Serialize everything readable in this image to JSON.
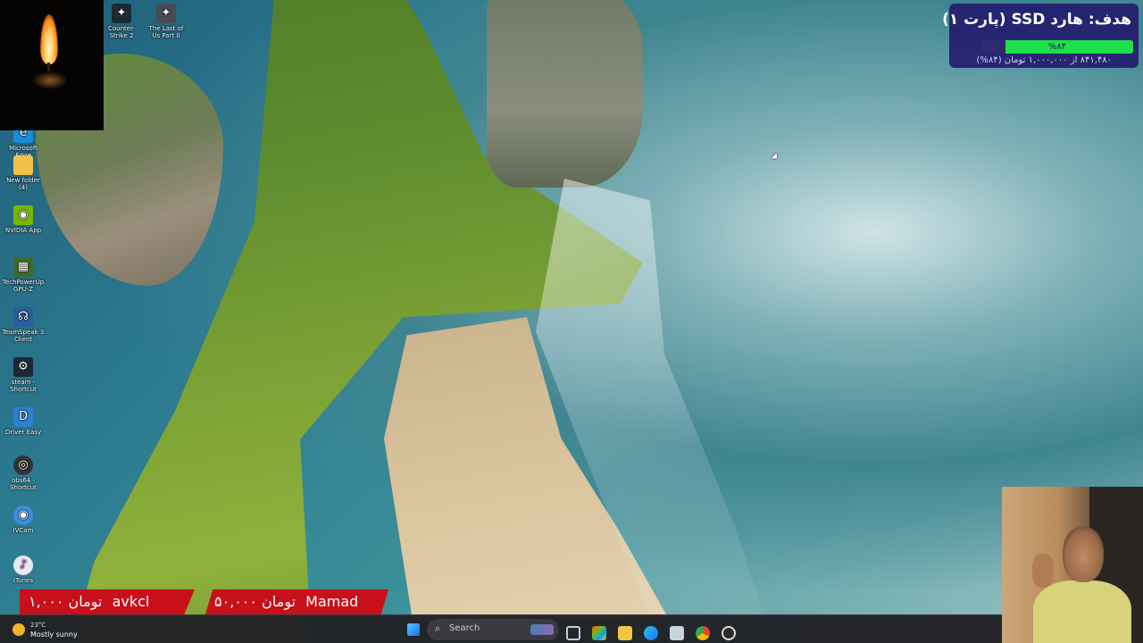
{
  "desktop": {
    "icons": [
      {
        "label": "Microsoft Edge",
        "icon": "edge-icon"
      },
      {
        "label": "New folder (4)",
        "icon": "folder-icon"
      },
      {
        "label": "NVIDIA App",
        "icon": "nvidia-icon"
      },
      {
        "label": "TechPowerUp GPU-Z",
        "icon": "gpuz-icon"
      },
      {
        "label": "TeamSpeak 3 Client",
        "icon": "teamspeak-icon"
      },
      {
        "label": "steam - Shortcut",
        "icon": "steam-icon"
      },
      {
        "label": "Driver Easy",
        "icon": "driver-easy-icon"
      },
      {
        "label": "obs64 - Shortcut",
        "icon": "obs-icon"
      },
      {
        "label": "IVCam",
        "icon": "ivcam-icon"
      },
      {
        "label": "iTunes",
        "icon": "itunes-icon"
      }
    ],
    "top_icons": [
      {
        "label": "Counter-Strike 2",
        "icon": "game-icon"
      },
      {
        "label": "The Last of Us Part II",
        "icon": "game-icon"
      }
    ]
  },
  "goal": {
    "title": "هدف: هارد SSD (پارت ۱)",
    "percent_label": "%۸۴",
    "progress": 0.84,
    "amount_text": "۸۴۱,۴۸۰ از ۱,۰۰۰,۰۰۰ تومان (۸۴%)",
    "bar_color": "#1fe04a"
  },
  "donations": [
    {
      "amount": "۱,۰۰۰ تومان",
      "name": "avkcl"
    },
    {
      "amount": "۵۰,۰۰۰ تومان",
      "name": "Mamad"
    }
  ],
  "taskbar": {
    "weather": {
      "temp": "23°C",
      "condition": "Mostly sunny"
    },
    "search_placeholder": "Search",
    "apps": [
      "task-view-icon",
      "store-icon",
      "file-explorer-icon",
      "edge-icon",
      "steam-icon",
      "chrome-icon",
      "obs-icon"
    ]
  },
  "colors": {
    "goal_bg": "#231c6e",
    "donation_bg": "#c8101a",
    "taskbar_bg": "#202024"
  }
}
